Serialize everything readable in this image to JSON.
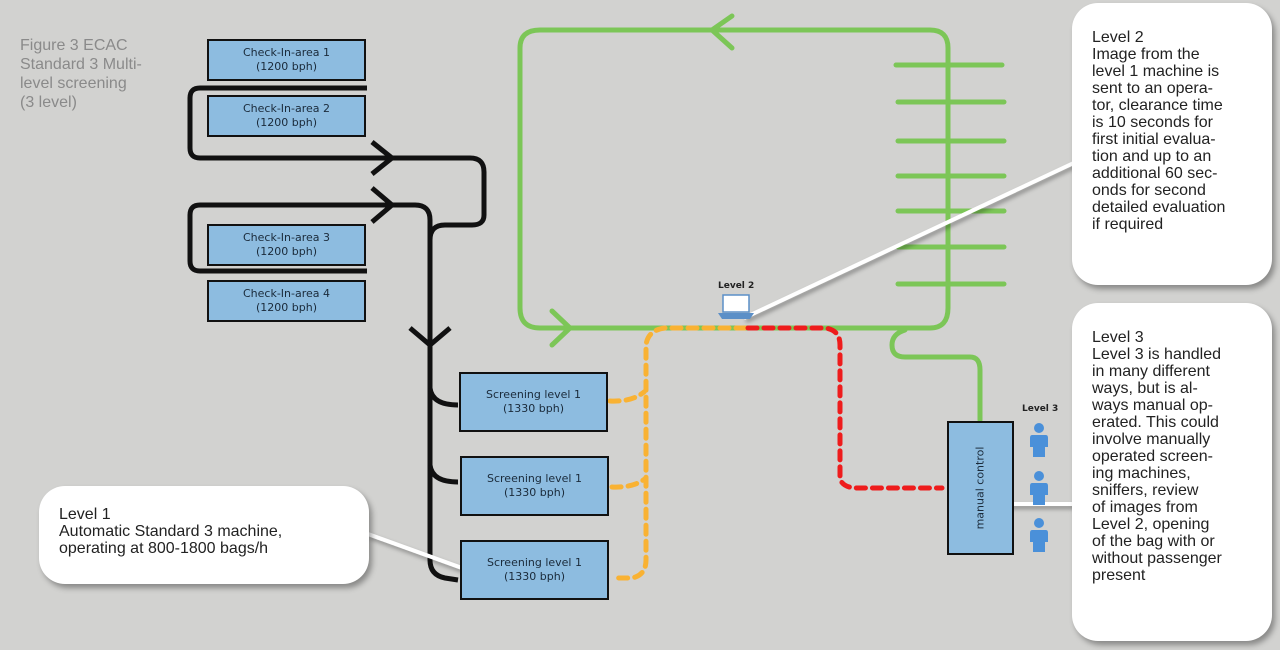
{
  "caption": {
    "lines": [
      "Figure 3 ECAC",
      "Standard 3 Multi-",
      "level screening",
      "(3 level)"
    ]
  },
  "checkin_areas": [
    {
      "name": "Check-In-area 1",
      "rate": "(1200 bph)"
    },
    {
      "name": "Check-In-area 2",
      "rate": "(1200 bph)"
    },
    {
      "name": "Check-In-area 3",
      "rate": "(1200 bph)"
    },
    {
      "name": "Check-In-area 4",
      "rate": "(1200 bph)"
    }
  ],
  "screening_machines": [
    {
      "name": "Screening level 1",
      "rate": "(1330 bph)"
    },
    {
      "name": "Screening level 1",
      "rate": "(1330 bph)"
    },
    {
      "name": "Screening level 1",
      "rate": "(1330 bph)"
    }
  ],
  "level2_station": {
    "label": "Level 2",
    "icon": "laptop-icon"
  },
  "level3_station": {
    "label": "Level 3",
    "icon": "person-icon",
    "operator_count": 3
  },
  "manual_control": {
    "label": "manual control"
  },
  "callouts": {
    "level1": {
      "lines": [
        "Level 1",
        "Automatic Standard 3 machine,",
        "operating at 800-1800 bags/h"
      ]
    },
    "level2": {
      "lines": [
        "Level 2",
        "Image from the",
        "level 1 machine is",
        "sent to an opera-",
        "tor, clearance time",
        "is 10 seconds for",
        "first initial evalua-",
        "tion and up to an",
        "additional 60 sec-",
        "onds for second",
        "detailed evaluation",
        "if required"
      ]
    },
    "level3": {
      "lines": [
        "Level 3",
        "Level 3 is handled",
        "in many different",
        "ways, but is al-",
        "ways manual op-",
        "erated. This could",
        "involve manually",
        "operated screen-",
        "ing machines,",
        "sniffers, review",
        "of images from",
        "Level 2, opening",
        "of the bag with or",
        "without passenger",
        "present"
      ]
    }
  },
  "colors": {
    "background": "#d2d2d0",
    "box_fill": "#8dbce0",
    "conveyor_main": "#111111",
    "conveyor_cleared": "#7cc657",
    "path_level2": "#f9b233",
    "path_level3": "#ee1c1c",
    "operator": "#4a90d9"
  }
}
